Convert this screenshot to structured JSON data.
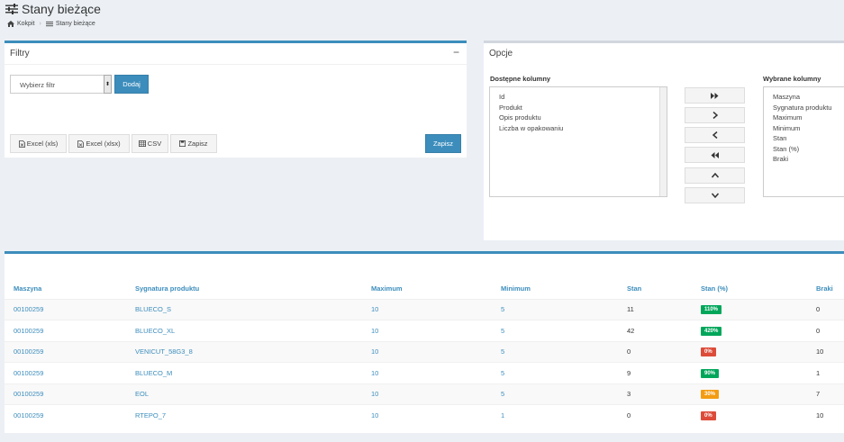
{
  "header": {
    "title": "Stany bieżące"
  },
  "breadcrumb": {
    "home": "Kokpit",
    "current": "Stany bieżące"
  },
  "filters": {
    "title": "Filtry",
    "collapse": "−",
    "select_placeholder": "Wybierz filtr",
    "add_label": "Dodaj",
    "export_xls": "Excel (xls)",
    "export_xlsx": "Excel (xlsx)",
    "export_csv": "CSV",
    "save_view": "Zapisz",
    "save_label": "Zapisz"
  },
  "options": {
    "title": "Opcje",
    "available_label": "Dostępne kolumny",
    "available": [
      "Id",
      "Produkt",
      "Opis produktu",
      "Liczba w opakowaniu"
    ],
    "selected_label": "Wybrane kolumny",
    "selected": [
      "Maszyna",
      "Sygnatura produktu",
      "Maximum",
      "Minimum",
      "Stan",
      "Stan (%)",
      "Braki"
    ]
  },
  "table": {
    "columns": [
      "Maszyna",
      "Sygnatura produktu",
      "Maximum",
      "Minimum",
      "Stan",
      "Stan (%)",
      "Braki"
    ],
    "rows": [
      {
        "machine": "00100259",
        "sig": "BLUECO_S",
        "max": "10",
        "min": "5",
        "stan": "11",
        "pct": "110%",
        "pct_color": "#00a65a",
        "braki": "0"
      },
      {
        "machine": "00100259",
        "sig": "BLUECO_XL",
        "max": "10",
        "min": "5",
        "stan": "42",
        "pct": "420%",
        "pct_color": "#00a65a",
        "braki": "0"
      },
      {
        "machine": "00100259",
        "sig": "VENICUT_58G3_8",
        "max": "10",
        "min": "5",
        "stan": "0",
        "pct": "0%",
        "pct_color": "#dd4b39",
        "braki": "10"
      },
      {
        "machine": "00100259",
        "sig": "BLUECO_M",
        "max": "10",
        "min": "5",
        "stan": "9",
        "pct": "90%",
        "pct_color": "#00a65a",
        "braki": "1"
      },
      {
        "machine": "00100259",
        "sig": "EOL",
        "max": "10",
        "min": "5",
        "stan": "3",
        "pct": "30%",
        "pct_color": "#f39c12",
        "braki": "7"
      },
      {
        "machine": "00100259",
        "sig": "RTEPO_7",
        "max": "10",
        "min": "1",
        "stan": "0",
        "pct": "0%",
        "pct_color": "#dd4b39",
        "braki": "10"
      }
    ]
  },
  "colors": {
    "accent": "#3c8dbc",
    "success": "#00a65a",
    "danger": "#dd4b39",
    "warning": "#f39c12"
  }
}
